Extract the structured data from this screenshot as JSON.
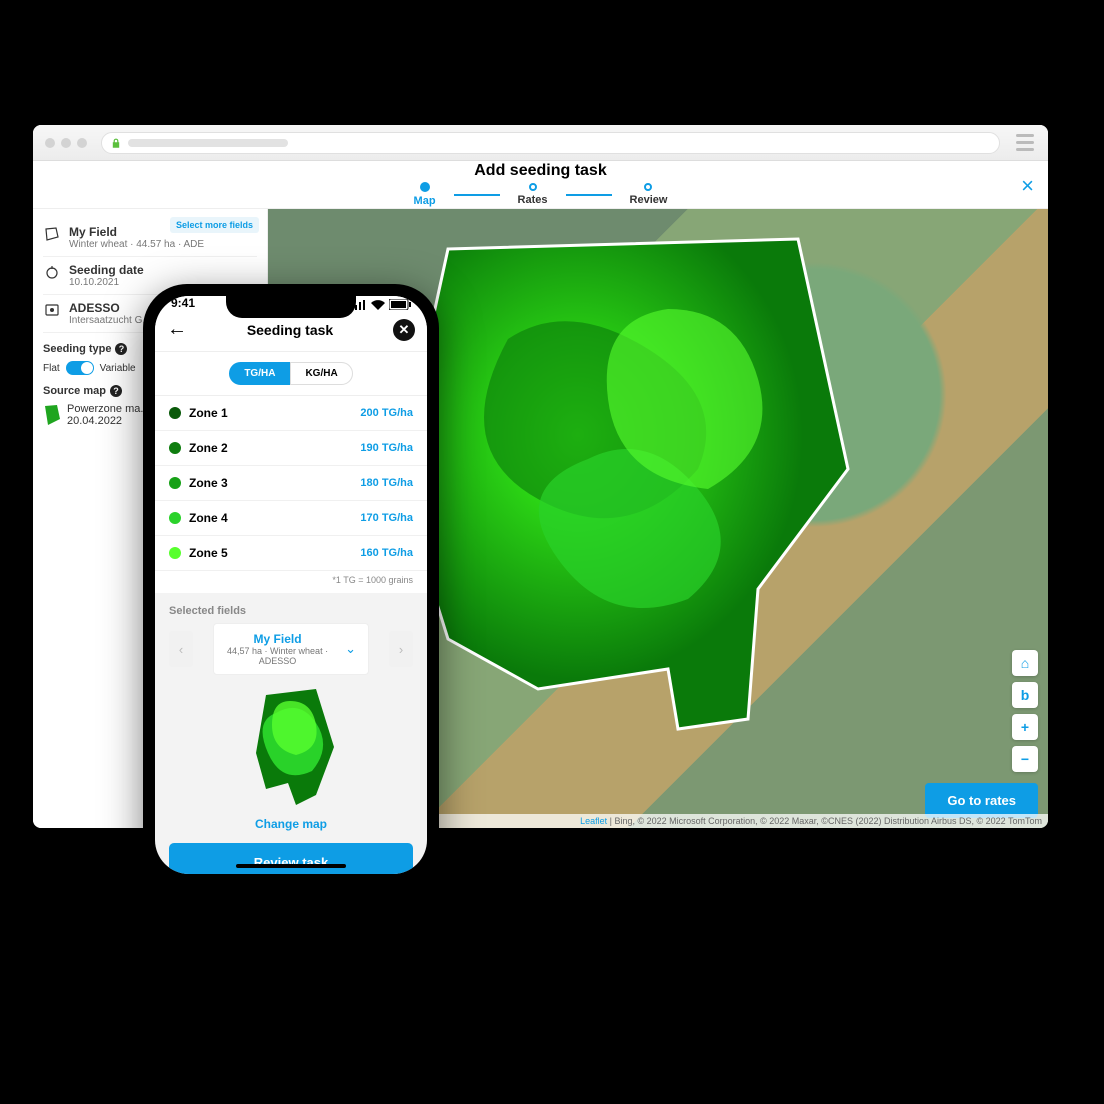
{
  "browser": {
    "header_title": "Add seeding task",
    "steps": [
      "Map",
      "Rates",
      "Review"
    ],
    "active_step": 0,
    "sidebar": {
      "field": {
        "title": "My Field",
        "sub": "Winter wheat · 44.57 ha · ADE"
      },
      "select_more": "Select more fields",
      "seeding_date": {
        "label": "Seeding date",
        "value": "10.10.2021"
      },
      "product": {
        "title": "ADESSO",
        "sub": "Intersaatzucht G..."
      },
      "seeding_type_label": "Seeding type",
      "toggle": {
        "left": "Flat",
        "right": "Variable",
        "on": true
      },
      "source_map_label": "Source map",
      "source_map": {
        "title": "Powerzone ma...",
        "date": "20.04.2022"
      }
    },
    "map": {
      "primary_button": "Go to rates",
      "attribution_leaflet": "Leaflet",
      "attribution_rest": " | Bing, © 2022 Microsoft Corporation, © 2022 Maxar, ©CNES (2022) Distribution Airbus DS, © 2022 TomTom",
      "controls": [
        "⌂",
        "b",
        "+",
        "−"
      ]
    }
  },
  "phone": {
    "time": "9:41",
    "title": "Seeding task",
    "units": {
      "active": "TG/HA",
      "inactive": "KG/HA"
    },
    "zones": [
      {
        "name": "Zone 1",
        "value": "200 TG/ha",
        "color": "#0a5a0a"
      },
      {
        "name": "Zone 2",
        "value": "190 TG/ha",
        "color": "#0f7d0f"
      },
      {
        "name": "Zone 3",
        "value": "180 TG/ha",
        "color": "#17a117"
      },
      {
        "name": "Zone 4",
        "value": "170 TG/ha",
        "color": "#2bd22b"
      },
      {
        "name": "Zone 5",
        "value": "160 TG/ha",
        "color": "#58ff2e"
      }
    ],
    "footnote": "*1 TG = 1000 grains",
    "selected_fields_label": "Selected fields",
    "field_card": {
      "name": "My Field",
      "sub": "44,57 ha · Winter wheat · ADESSO"
    },
    "change_map": "Change map",
    "review": "Review task"
  }
}
